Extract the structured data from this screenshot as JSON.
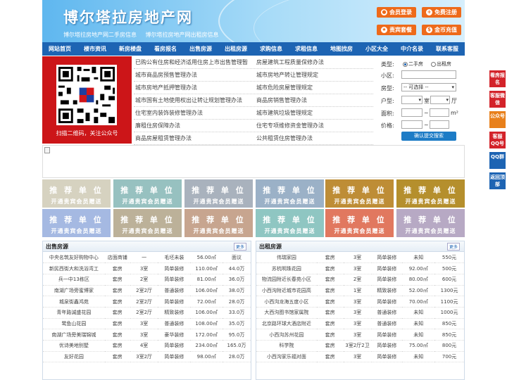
{
  "header": {
    "title": "博尔塔拉房地产网",
    "subtitle": [
      "博尔塔拉房地产网二手房信息",
      "博尔塔拉房地产网出租房信息"
    ],
    "buttons": [
      "会员登录",
      "免费注册",
      "责宾套餐",
      "金币充值"
    ]
  },
  "nav": [
    "网站首页",
    "楼市资讯",
    "新房楼盘",
    "看房报名",
    "出售房源",
    "出租房源",
    "求购信息",
    "求租信息",
    "地图找房",
    "小区大全",
    "中介名录",
    "联系客服"
  ],
  "qr": {
    "caption": "扫描二维码，关注公众号"
  },
  "links": [
    [
      "已购公有住房和经济适用住房上市出售管理暂",
      "房屋建筑工程质量保修办法"
    ],
    [
      "城市商品房预售管理办法",
      "城市房地产转让管理规定"
    ],
    [
      "城市房地产抵押管理办法",
      "城市危险房屋管理规定"
    ],
    [
      "城市国有土地使用权出让转让规划管理办法",
      "商品房销售管理办法"
    ],
    [
      "住宅室内装饰装修管理办法",
      "城市建筑垃圾管理规定"
    ],
    [
      "廉租住房保障办法",
      "住宅专项维修资金管理办法"
    ],
    [
      "商品房屋租赁管理办法",
      "公共租赁住房管理办法"
    ]
  ],
  "search": {
    "type_label": "类型:",
    "type_options": [
      "二手房",
      "出租房"
    ],
    "area_label": "小区:",
    "house_label": "房型:",
    "house_value": "-- 可选择 --",
    "layout_label": "户型:",
    "room_unit": "室",
    "hall_unit": "厅",
    "size_label": "面积:",
    "size_unit": "m²",
    "price_label": "价格:",
    "to": "~",
    "submit": "确认提交搜索"
  },
  "ads": {
    "line1": "推 荐 单 位",
    "line2": "开通贵宾会员赠送",
    "colors": [
      "#d6d2c0",
      "#97c1c0",
      "#a9b2bd",
      "#9bb1c7",
      "#be8d36",
      "#b58f2d",
      "#a5b9e2",
      "#bcb199",
      "#c7a58f",
      "#8fc6c2",
      "#e1785f",
      "#b7a9c4"
    ]
  },
  "sale": {
    "title": "出售房源",
    "more": "更多",
    "rows": [
      [
        "中央名筑友好购物中心",
        "店面商铺",
        "一",
        "毛坯未装",
        "56.00㎡",
        "面议"
      ],
      [
        "新民西街大和洗浴湾工",
        "套房",
        "3室",
        "简单装修",
        "110.00㎡",
        "44.0万"
      ],
      [
        "兵一中13栋区",
        "套房",
        "2室",
        "简单装修",
        "81.00㎡",
        "36.0万"
      ],
      [
        "南湖广场旁蜜博家",
        "套房",
        "2室2厅",
        "普通装修",
        "106.00㎡",
        "38.0万"
      ],
      [
        "城泉街鑫鸿苑",
        "套房",
        "2室2厅",
        "简单装修",
        "72.00㎡",
        "28.0万"
      ],
      [
        "青年路诚盛花园",
        "套房",
        "2室2厅",
        "精致装修",
        "106.00㎡",
        "33.0万"
      ],
      [
        "鹭鱼山花园",
        "套房",
        "3室",
        "普通装修",
        "108.00㎡",
        "35.0万"
      ],
      [
        "南湖广场旁美瑞锦城",
        "套房",
        "3室",
        "豪华装修",
        "172.00㎡",
        "95.0万"
      ],
      [
        "优诗美地别墅",
        "套房",
        "4室",
        "简单装修",
        "234.00㎡",
        "165.0万"
      ],
      [
        "友好花园",
        "套房",
        "3室2厅",
        "简单装修",
        "98.00㎡",
        "28.0万"
      ]
    ]
  },
  "rent": {
    "title": "出租房源",
    "more": "更多",
    "rows": [
      [
        "伟瑞家园",
        "套房",
        "3室",
        "简单装修",
        "未知",
        "550元"
      ],
      [
        "苏杭明珠花园",
        "套房",
        "3室",
        "简单装修",
        "92.00㎡",
        "500元"
      ],
      [
        "物流园附近长春苑小区",
        "套房",
        "2室",
        "简单装修",
        "80.00㎡",
        "600元"
      ],
      [
        "小西沟附近城市花园高",
        "套房",
        "1室",
        "精致装修",
        "52.00㎡",
        "1300元"
      ],
      [
        "小西沟龙海五度小区",
        "套房",
        "3室",
        "简单装修",
        "70.00㎡",
        "1100元"
      ],
      [
        "大西沟图书馆家属院",
        "套房",
        "3室",
        "普通装修",
        "未知",
        "1000元"
      ],
      [
        "北京路环球大酒店附近",
        "套房",
        "3室",
        "普通装修",
        "未知",
        "850元"
      ],
      [
        "小西沟苏州花园",
        "套房",
        "3室",
        "简单装修",
        "未知",
        "850元"
      ],
      [
        "科学院",
        "套房",
        "3室2厅2卫",
        "简单装修",
        "75.00㎡",
        "800元"
      ],
      [
        "小西沟家乐福对面",
        "套房",
        "3室",
        "简单装修",
        "未知",
        "700元"
      ]
    ]
  },
  "float": [
    "看房报名",
    "客服微信",
    "公众号",
    "客服QQ号",
    "QQ群",
    "返回顶部"
  ]
}
